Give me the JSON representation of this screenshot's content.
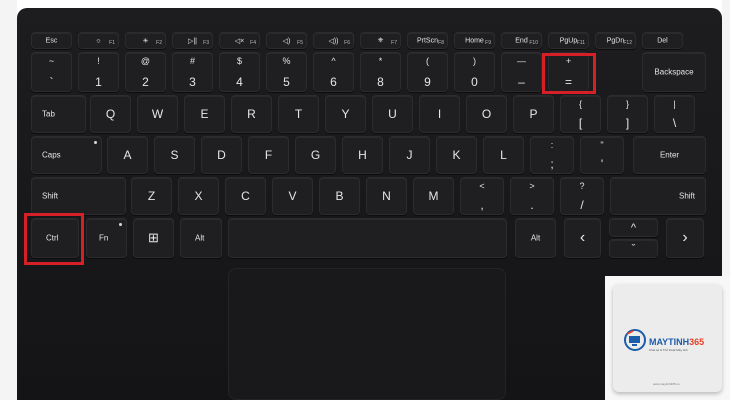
{
  "frows": [
    [
      {
        "m": "Esc"
      },
      {
        "m": "☼",
        "s": "F1"
      },
      {
        "m": "☀",
        "s": "F2"
      },
      {
        "m": "▷||",
        "s": "F3"
      },
      {
        "m": "◁×",
        "s": "F4"
      },
      {
        "m": "◁)",
        "s": "F5"
      },
      {
        "m": "◁))",
        "s": "F6"
      },
      {
        "m": "⎈",
        "s": "F7"
      },
      {
        "m": "PrtScn",
        "s": "F8"
      },
      {
        "m": "Home",
        "s": "F9"
      },
      {
        "m": "End",
        "s": "F10"
      },
      {
        "m": "PgUp",
        "s": "F11"
      },
      {
        "m": "PgDn",
        "s": "F12"
      },
      {
        "m": "Del"
      }
    ]
  ],
  "numrow": [
    {
      "t": "~",
      "b": "`"
    },
    {
      "t": "!",
      "b": "1"
    },
    {
      "t": "@",
      "b": "2"
    },
    {
      "t": "#",
      "b": "3"
    },
    {
      "t": "$",
      "b": "4"
    },
    {
      "t": "%",
      "b": "5"
    },
    {
      "t": "^",
      "b": "6"
    },
    {
      "t": "*",
      "b": "8"
    },
    {
      "t": "(",
      "b": "9"
    },
    {
      "t": ")",
      "b": "0"
    },
    {
      "t": "—",
      "b": "–"
    },
    {
      "t": "+",
      "b": "="
    }
  ],
  "backspace": "Backspace",
  "qrow": {
    "tab": "Tab",
    "letters": [
      "Q",
      "W",
      "E",
      "R",
      "T",
      "Y",
      "U",
      "I",
      "O",
      "P"
    ],
    "p1": {
      "t": "{",
      "b": "["
    },
    "p2": {
      "t": "}",
      "b": "]"
    },
    "p3": {
      "t": "|",
      "b": "\\"
    }
  },
  "arow": {
    "caps": "Caps",
    "letters": [
      "A",
      "S",
      "D",
      "F",
      "G",
      "H",
      "J",
      "K",
      "L"
    ],
    "p1": {
      "t": ":",
      "b": ";"
    },
    "p2": {
      "t": "\"",
      "b": "'"
    },
    "enter": "Enter"
  },
  "zrow": {
    "shift_l": "Shift",
    "letters": [
      "Z",
      "X",
      "C",
      "V",
      "B",
      "N",
      "M"
    ],
    "p1": {
      "t": "<",
      "b": ","
    },
    "p2": {
      "t": ">",
      "b": "."
    },
    "p3": {
      "t": "?",
      "b": "/"
    },
    "shift_r": "Shift"
  },
  "bottom": {
    "ctrl": "Ctrl",
    "fn": "Fn",
    "win": "⊞",
    "alt_l": "Alt",
    "alt_r": "Alt",
    "left": "‹",
    "up": "^",
    "down": "ˇ",
    "right": "›"
  },
  "logo": {
    "brand": "MAYTINH",
    "num": "365",
    "tagline": "Chia sẻ & Thủ thuật Máy tính",
    "site": "www.maytinh365.vn"
  },
  "highlight_color": "#d62027"
}
